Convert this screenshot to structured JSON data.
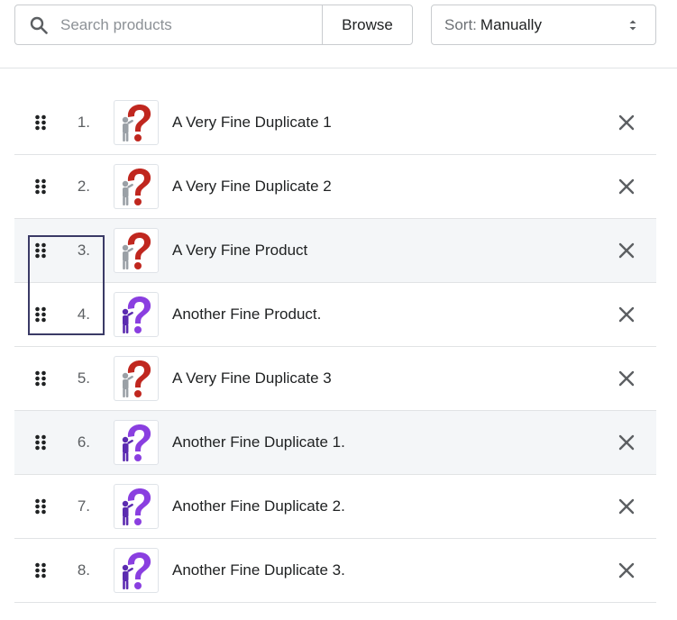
{
  "search": {
    "placeholder": "Search products",
    "browse_label": "Browse"
  },
  "sort": {
    "label": "Sort:",
    "value": "Manually"
  },
  "products": [
    {
      "index": "1.",
      "title": "A Very Fine Duplicate 1",
      "image": "red-question-mark",
      "shaded": false
    },
    {
      "index": "2.",
      "title": "A Very Fine Duplicate 2",
      "image": "red-question-mark",
      "shaded": false
    },
    {
      "index": "3.",
      "title": "A Very Fine Product",
      "image": "red-question-mark",
      "shaded": true
    },
    {
      "index": "4.",
      "title": "Another Fine Product.",
      "image": "purple-question-mark",
      "shaded": false
    },
    {
      "index": "5.",
      "title": "A Very Fine Duplicate 3",
      "image": "red-question-mark",
      "shaded": false
    },
    {
      "index": "6.",
      "title": "Another Fine Duplicate 1.",
      "image": "purple-question-mark",
      "shaded": true
    },
    {
      "index": "7.",
      "title": "Another Fine Duplicate 2.",
      "image": "purple-question-mark",
      "shaded": false
    },
    {
      "index": "8.",
      "title": "Another Fine Duplicate 3.",
      "image": "purple-question-mark",
      "shaded": false
    }
  ],
  "colors": {
    "red_question": "#c0271f",
    "purple_question": "#8a3fe0",
    "icon_gray": "#5c5f62"
  }
}
